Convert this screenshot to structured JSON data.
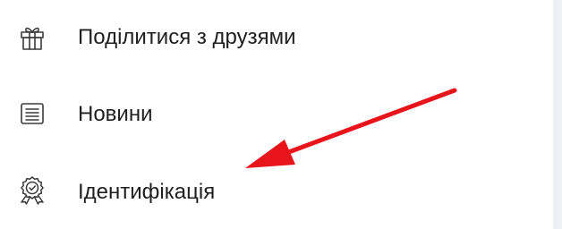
{
  "menu": {
    "items": [
      {
        "label": "Поділитися з друзями",
        "icon": "gift-icon"
      },
      {
        "label": "Новини",
        "icon": "news-icon"
      },
      {
        "label": "Ідентифікація",
        "icon": "badge-check-icon"
      }
    ]
  },
  "annotation": {
    "type": "arrow",
    "color": "#e8141b"
  }
}
